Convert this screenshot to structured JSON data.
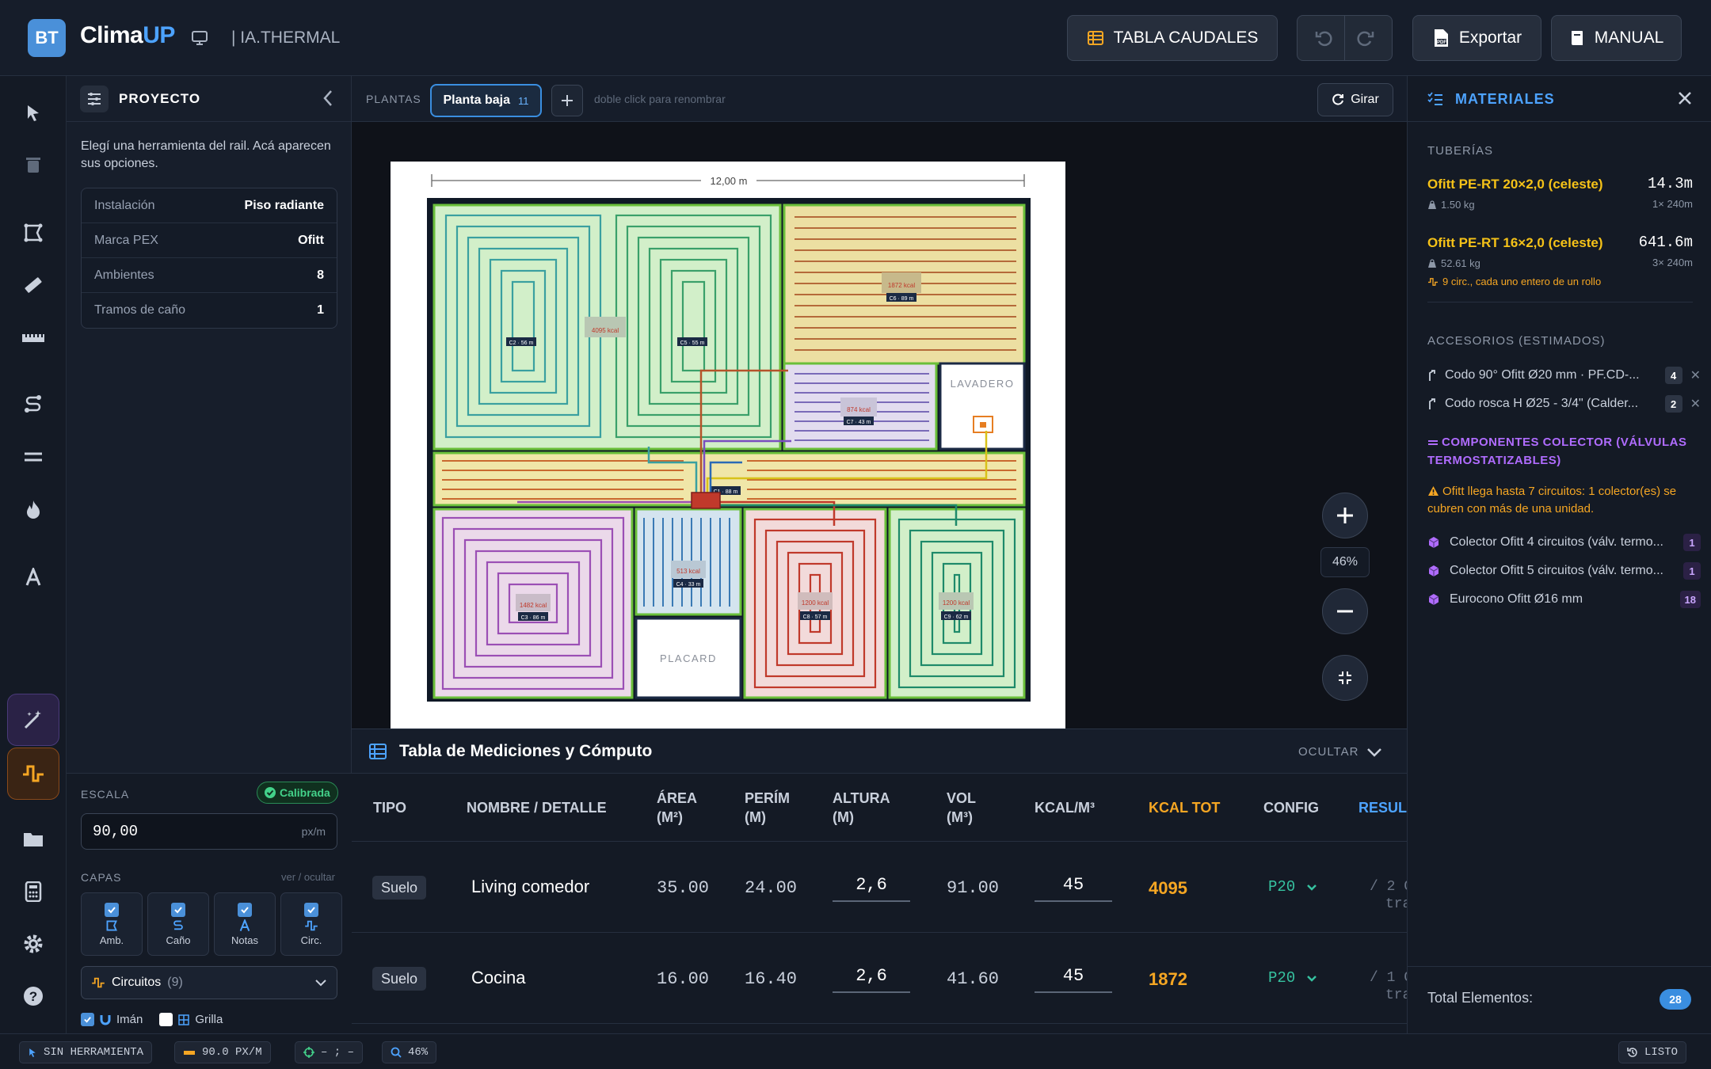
{
  "header": {
    "logo_badge": "BT",
    "app_name_main": "Clima",
    "app_name_accent": "UP",
    "brand_sub": "| IA.THERMAL",
    "tabla_caudales_label": "TABLA CAUDALES",
    "export_label": "Exportar",
    "manual_label": "MANUAL"
  },
  "rail": {
    "icons": [
      "select-icon",
      "trash-icon",
      "room-icon",
      "ruler-icon",
      "measure-icon",
      "pipe-route-icon",
      "double-line-icon",
      "flame-icon",
      "text-icon",
      "magic-wand-icon",
      "circuit-icon",
      "folder-icon",
      "calculator-icon",
      "gear-icon",
      "help-icon"
    ]
  },
  "project": {
    "title": "PROYECTO",
    "hint": "Elegí una herramienta del rail. Acá aparecen sus opciones.",
    "info": [
      {
        "key": "Instalación",
        "value": "Piso radiante"
      },
      {
        "key": "Marca PEX",
        "value": "Ofitt"
      },
      {
        "key": "Ambientes",
        "value": "8"
      },
      {
        "key": "Tramos de caño",
        "value": "1"
      }
    ],
    "scale_label": "ESCALA",
    "calibrated_label": "Calibrada",
    "scale_value": "90,00",
    "scale_unit": "px/m",
    "layers_label": "CAPAS",
    "layers_toggle": "ver / ocultar",
    "layers": [
      "Amb.",
      "Caño",
      "Notas",
      "Circ."
    ],
    "circuits_select": "Circuitos",
    "circuits_count": "(9)",
    "iman_label": "Imán",
    "grilla_label": "Grilla"
  },
  "plantas": {
    "label": "PLANTAS",
    "active_tab": "Planta baja",
    "active_count": "11",
    "rename_hint": "doble click para renombrar",
    "girar_label": "Girar"
  },
  "plan": {
    "dimension_label": "12,00 m",
    "room_labels": {
      "lavadero": "LAVADERO",
      "placard": "PLACARD"
    },
    "circuit_tags": [
      "C2 · 56 m",
      "C5 · 55 m",
      "C6 · 89 m",
      "C7 · 43 m",
      "C4 · 33 m",
      "C3 · 86 m",
      "C8 · 57 m",
      "C9 · 62 m",
      "C1 · 88 m"
    ],
    "kcal_tags": [
      "4095 kcal",
      "1872 kcal",
      "874 kcal",
      "513 kcal",
      "1482 kcal",
      "1200 kcal",
      "1200 kcal"
    ]
  },
  "zoom": {
    "level": "46%"
  },
  "table": {
    "title": "Tabla de Mediciones y Cómputo",
    "hide_label": "OCULTAR",
    "columns": {
      "tipo": "TIPO",
      "nombre": "NOMBRE / DETALLE",
      "area_1": "ÁREA",
      "area_2": "(M²)",
      "perim_1": "PERÍM",
      "perim_2": "(M)",
      "altura_1": "ALTURA",
      "altura_2": "(M)",
      "vol_1": "VOL",
      "vol_2": "(M³)",
      "kcalm3": "KCAL/M³",
      "kcaltot": "KCAL TOT",
      "config": "CONFIG",
      "resul": "RESUL"
    },
    "rows": [
      {
        "tipo": "Suelo",
        "nombre": "Living comedor",
        "area": "35.00",
        "perim": "24.00",
        "altura": "2,6",
        "vol": "91.00",
        "kcalm3": "45",
        "kcaltot": "4095",
        "config": "P20",
        "resul_1": "/ 2 C",
        "resul_2": "tra:"
      },
      {
        "tipo": "Suelo",
        "nombre": "Cocina",
        "area": "16.00",
        "perim": "16.40",
        "altura": "2,6",
        "vol": "41.60",
        "kcalm3": "45",
        "kcaltot": "1872",
        "config": "P20",
        "resul_1": "/ 1 C",
        "resul_2": "tra:"
      }
    ]
  },
  "materials": {
    "title": "MATERIALES",
    "tuberias_label": "TUBERÍAS",
    "pipes": [
      {
        "name": "Ofitt PE-RT 20×2,0 (celeste)",
        "length": "14.3m",
        "weight": "1.50 kg",
        "rolls": "1× 240m"
      },
      {
        "name": "Ofitt PE-RT 16×2,0 (celeste)",
        "length": "641.6m",
        "weight": "52.61 kg",
        "rolls": "3× 240m",
        "note": "9 circ., cada uno entero de un rollo"
      }
    ],
    "accesorios_label": "ACCESORIOS (ESTIMADOS)",
    "accessories": [
      {
        "name": "Codo 90° Ofitt Ø20 mm · PF.CD-...",
        "qty": "4"
      },
      {
        "name": "Codo rosca H Ø25 - 3/4\" (Calder...",
        "qty": "2"
      }
    ],
    "colector_title": "COMPONENTES COLECTOR (VÁLVULAS TERMOSTATIZABLES)",
    "warning": "Ofitt llega hasta 7 circuitos: 1 colector(es) se cubren con más de una unidad.",
    "components": [
      {
        "name": "Colector Ofitt 4 circuitos (válv. termo...",
        "qty": "1"
      },
      {
        "name": "Colector Ofitt 5 circuitos (válv. termo...",
        "qty": "1"
      },
      {
        "name": "Eurocono Ofitt Ø16 mm",
        "qty": "18"
      }
    ],
    "total_label": "Total Elementos:",
    "total_value": "28"
  },
  "status": {
    "tool": "SIN HERRAMIENTA",
    "scale": "90.0 PX/M",
    "coords": "– ; –",
    "zoom": "46%",
    "state": "LISTO"
  }
}
